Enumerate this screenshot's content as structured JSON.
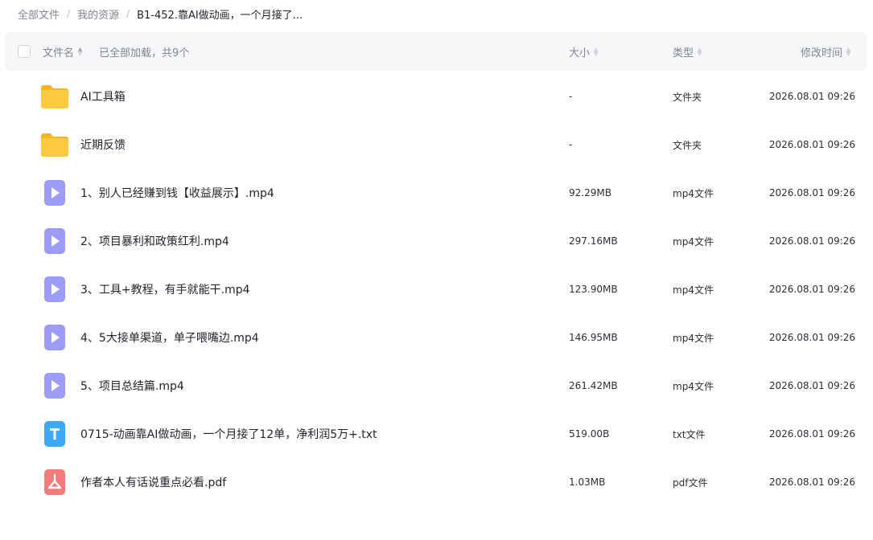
{
  "breadcrumb": {
    "items": [
      "全部文件",
      "我的资源",
      "B1-452.靠AI做动画，一个月接了..."
    ],
    "separator": "/"
  },
  "table": {
    "headers": {
      "name": "文件名",
      "loaded_note": "已全部加载，共9个",
      "size": "大小",
      "type": "类型",
      "modified": "修改时间"
    },
    "rows": [
      {
        "name": "AI工具箱",
        "size": "-",
        "type": "文件夹",
        "modified": "2026.08.01 09:26",
        "icon": "folder-icon"
      },
      {
        "name": "近期反馈",
        "size": "-",
        "type": "文件夹",
        "modified": "2026.08.01 09:26",
        "icon": "folder-icon"
      },
      {
        "name": "1、别人已经赚到钱【收益展示】.mp4",
        "size": "92.29MB",
        "type": "mp4文件",
        "modified": "2026.08.01 09:26",
        "icon": "video-file-icon"
      },
      {
        "name": "2、项目暴利和政策红利.mp4",
        "size": "297.16MB",
        "type": "mp4文件",
        "modified": "2026.08.01 09:26",
        "icon": "video-file-icon"
      },
      {
        "name": "3、工具+教程，有手就能干.mp4",
        "size": "123.90MB",
        "type": "mp4文件",
        "modified": "2026.08.01 09:26",
        "icon": "video-file-icon"
      },
      {
        "name": "4、5大接单渠道，单子喂嘴边.mp4",
        "size": "146.95MB",
        "type": "mp4文件",
        "modified": "2026.08.01 09:26",
        "icon": "video-file-icon"
      },
      {
        "name": "5、项目总结篇.mp4",
        "size": "261.42MB",
        "type": "mp4文件",
        "modified": "2026.08.01 09:26",
        "icon": "video-file-icon"
      },
      {
        "name": "0715-动画靠AI做动画，一个月接了12单，净利润5万+.txt",
        "size": "519.00B",
        "type": "txt文件",
        "modified": "2026.08.01 09:26",
        "icon": "text-file-icon"
      },
      {
        "name": "作者本人有话说重点必看.pdf",
        "size": "1.03MB",
        "type": "pdf文件",
        "modified": "2026.08.01 09:26",
        "icon": "pdf-file-icon"
      }
    ]
  },
  "colors": {
    "folder": "#fcc43c",
    "video": "#8f93f5",
    "text": "#3da8f5",
    "pdf": "#f46c6c",
    "header_bg": "#f6f7f9"
  }
}
